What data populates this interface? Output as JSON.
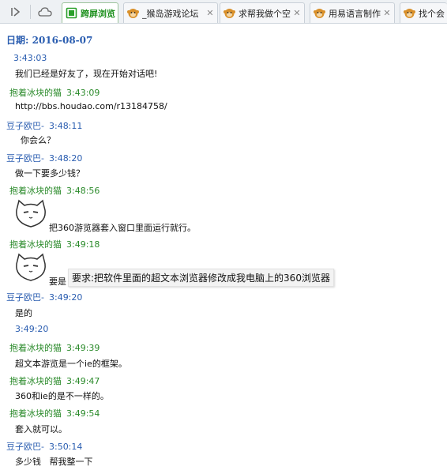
{
  "tabs": [
    {
      "title": "跨屏浏览",
      "active": true
    },
    {
      "title": "_猴岛游戏论坛"
    },
    {
      "title": "求帮我做个空"
    },
    {
      "title": "用易语言制作"
    },
    {
      "title": "找个会"
    }
  ],
  "date_label": "日期: 2016-08-07",
  "entries": [
    {
      "sender": "",
      "time": "3:43:03",
      "text": "我们已经是好友了，现在开始对话吧!"
    },
    {
      "sender": "抱着冰块的猫",
      "time": "3:43:09",
      "text": "http://bbs.houdao.com/r13184758/"
    },
    {
      "sender": "豆子欧巴-",
      "time": "3:48:11",
      "text": "你会么？"
    },
    {
      "sender": "豆子欧巴-",
      "time": "3:48:20",
      "text": "做一下要多少钱？"
    },
    {
      "sender": "抱着冰块的猫",
      "time": "3:48:56",
      "text": "把360游览器套入窗口里面运行就行。"
    },
    {
      "sender": "抱着冰块的猫",
      "time": "3:49:18",
      "text": "要是",
      "popup": "要求:把软件里面的超文本浏览器修改成我电脑上的360浏览器"
    },
    {
      "sender": "豆子欧巴-",
      "time": "3:49:20",
      "text": "是的"
    },
    {
      "sender": "",
      "time": "3:49:20",
      "text": ""
    },
    {
      "sender": "抱着冰块的猫",
      "time": "3:49:39",
      "text": "超文本游览是一个ie的框架。"
    },
    {
      "sender": "抱着冰块的猫",
      "time": "3:49:47",
      "text": "360和ie的是不一样的。"
    },
    {
      "sender": "抱着冰块的猫",
      "time": "3:49:54",
      "text": "套入就可以。"
    },
    {
      "sender": "豆子欧巴-",
      "time": "3:50:14",
      "text": "多少钱   帮我整一下"
    }
  ],
  "colors": {
    "green": "#2a8a2a",
    "blue": "#2a5db0",
    "date": "#2a5db0"
  },
  "icons": {
    "forward": "play-forward-icon",
    "cloud": "cloud-icon",
    "favicon": "monkey-favicon-icon",
    "active_favicon": "cross-screen-browse-icon",
    "avatar": "cat-avatar-icon"
  }
}
